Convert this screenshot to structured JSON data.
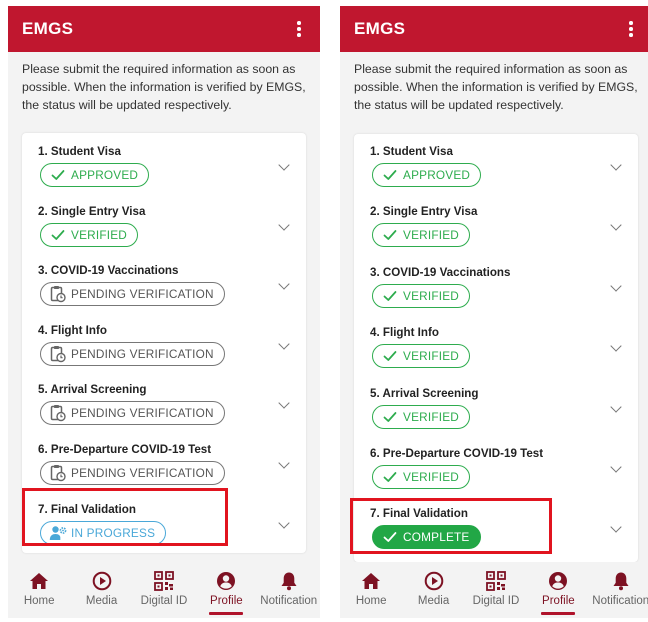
{
  "colors": {
    "brand": "#c0172f",
    "approved": "#2eac4e",
    "pending": "#777777",
    "in_progress": "#4aa8d8",
    "highlight": "#e1141f"
  },
  "screens": [
    {
      "app_title": "EMGS",
      "intro": "Please submit the required information as soon as possible. When the information is verified by EMGS, the status will be updated respectively.",
      "steps": [
        {
          "title": "1. Student Visa",
          "status": "APPROVED",
          "kind": "ok",
          "icon": "check-icon"
        },
        {
          "title": "2. Single Entry Visa",
          "status": "VERIFIED",
          "kind": "ok",
          "icon": "check-icon"
        },
        {
          "title": "3. COVID-19 Vaccinations",
          "status": "PENDING VERIFICATION",
          "kind": "pending",
          "icon": "clipboard-clock-icon"
        },
        {
          "title": "4. Flight Info",
          "status": "PENDING VERIFICATION",
          "kind": "pending",
          "icon": "clipboard-clock-icon"
        },
        {
          "title": "5. Arrival Screening",
          "status": "PENDING VERIFICATION",
          "kind": "pending",
          "icon": "clipboard-clock-icon"
        },
        {
          "title": "6. Pre-Departure COVID-19 Test",
          "status": "PENDING VERIFICATION",
          "kind": "pending",
          "icon": "clipboard-clock-icon"
        },
        {
          "title": "7. Final Validation",
          "status": "IN PROGRESS",
          "kind": "progress",
          "icon": "user-gear-icon"
        }
      ]
    },
    {
      "app_title": "EMGS",
      "intro": "Please submit the required information as soon as possible. When the information is verified by EMGS, the status will be updated respectively.",
      "steps": [
        {
          "title": "1. Student Visa",
          "status": "APPROVED",
          "kind": "ok",
          "icon": "check-icon"
        },
        {
          "title": "2. Single Entry Visa",
          "status": "VERIFIED",
          "kind": "ok",
          "icon": "check-icon"
        },
        {
          "title": "3. COVID-19 Vaccinations",
          "status": "VERIFIED",
          "kind": "ok",
          "icon": "check-icon"
        },
        {
          "title": "4. Flight Info",
          "status": "VERIFIED",
          "kind": "ok",
          "icon": "check-icon"
        },
        {
          "title": "5. Arrival Screening",
          "status": "VERIFIED",
          "kind": "ok",
          "icon": "check-icon"
        },
        {
          "title": "6. Pre-Departure COVID-19 Test",
          "status": "VERIFIED",
          "kind": "ok",
          "icon": "check-icon"
        },
        {
          "title": "7. Final Validation",
          "status": "COMPLETE",
          "kind": "complete",
          "icon": "check-icon"
        }
      ]
    }
  ],
  "nav": [
    {
      "label": "Home",
      "icon": "home-icon",
      "active": false
    },
    {
      "label": "Media",
      "icon": "play-circle-icon",
      "active": false
    },
    {
      "label": "Digital ID",
      "icon": "qr-code-icon",
      "active": false
    },
    {
      "label": "Profile",
      "icon": "profile-icon",
      "active": true
    },
    {
      "label": "Notification",
      "icon": "bell-icon",
      "active": false
    }
  ]
}
